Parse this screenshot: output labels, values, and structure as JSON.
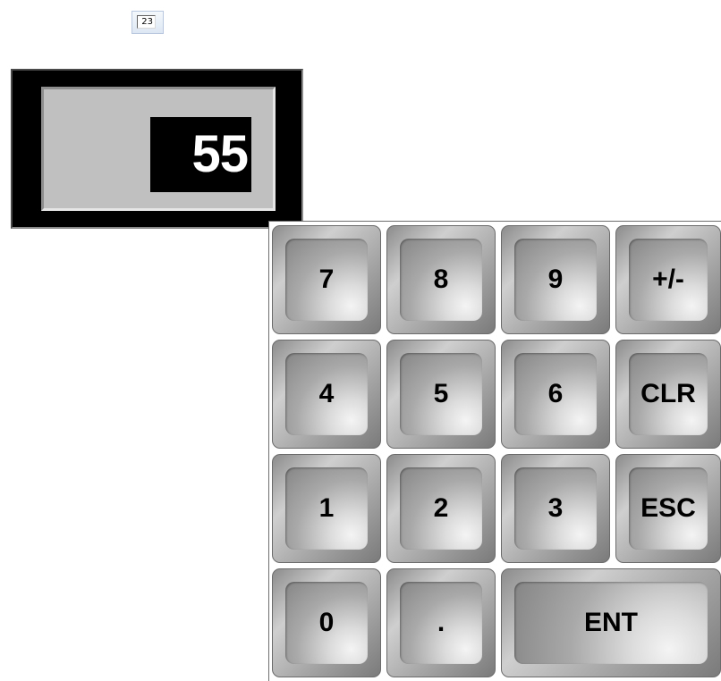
{
  "tool_icon": {
    "value": "23",
    "icon": "numeric-input-icon"
  },
  "display": {
    "value": "55"
  },
  "keypad": {
    "rows": [
      [
        {
          "label": "7",
          "name": "key-7"
        },
        {
          "label": "8",
          "name": "key-8"
        },
        {
          "label": "9",
          "name": "key-9"
        },
        {
          "label": "+/-",
          "name": "key-plus-minus"
        }
      ],
      [
        {
          "label": "4",
          "name": "key-4"
        },
        {
          "label": "5",
          "name": "key-5"
        },
        {
          "label": "6",
          "name": "key-6"
        },
        {
          "label": "CLR",
          "name": "key-clear"
        }
      ],
      [
        {
          "label": "1",
          "name": "key-1"
        },
        {
          "label": "2",
          "name": "key-2"
        },
        {
          "label": "3",
          "name": "key-3"
        },
        {
          "label": "ESC",
          "name": "key-escape"
        }
      ],
      [
        {
          "label": "0",
          "name": "key-0"
        },
        {
          "label": ".",
          "name": "key-decimal"
        },
        {
          "label": "ENT",
          "name": "key-enter"
        }
      ]
    ]
  }
}
